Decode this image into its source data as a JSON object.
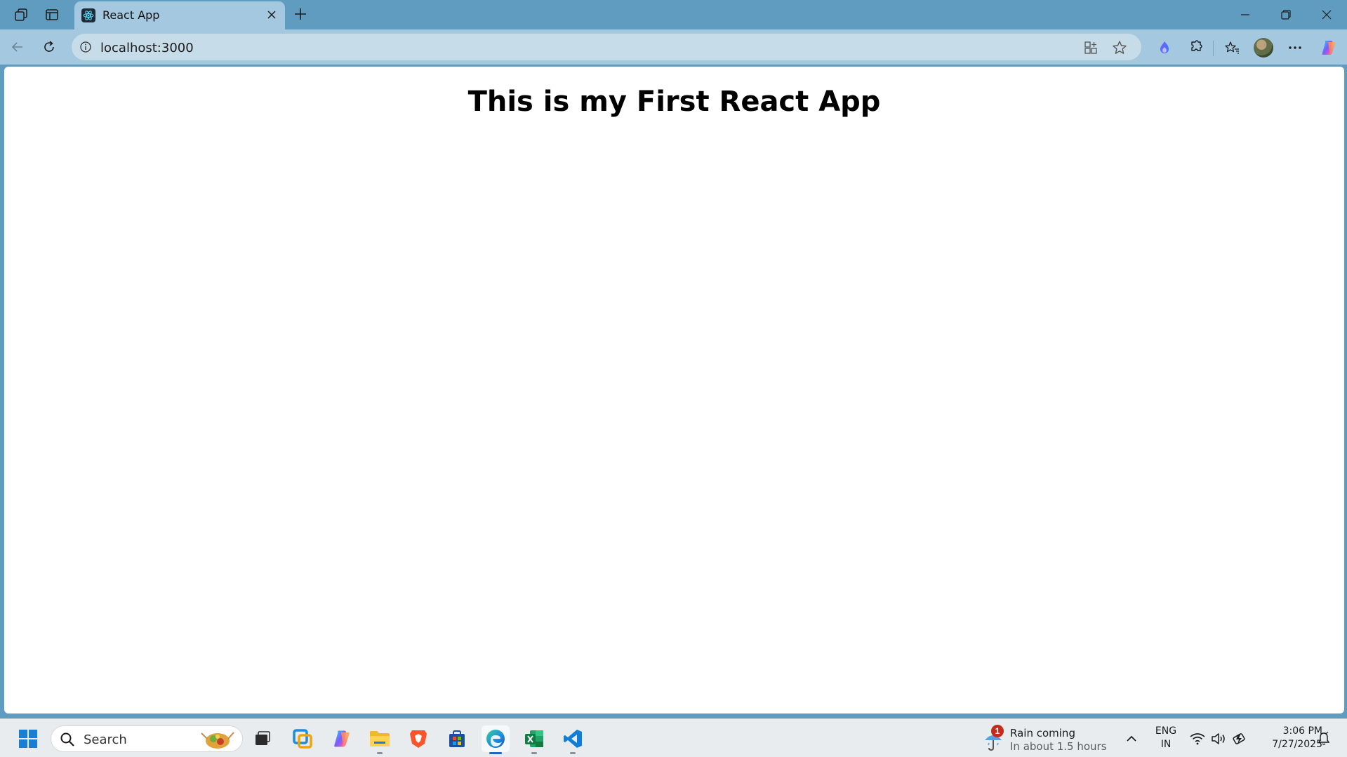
{
  "browser": {
    "tab": {
      "title": "React App"
    },
    "address_bar": {
      "url": "localhost:3000"
    }
  },
  "page": {
    "heading": "This is my First React App"
  },
  "taskbar": {
    "search": {
      "placeholder": "Search"
    },
    "apps": [
      "task-view",
      "microsoft-365",
      "copilot",
      "file-explorer",
      "brave",
      "microsoft-store",
      "edge",
      "excel",
      "vscode"
    ],
    "weather": {
      "badge": "1",
      "title": "Rain coming",
      "subtitle": "In about 1.5 hours"
    },
    "language": {
      "line1": "ENG",
      "line2": "IN"
    },
    "clock": {
      "time": "3:06 PM",
      "date": "7/27/2025"
    }
  },
  "colors": {
    "titlebar": "#5f9cc0",
    "toolbar": "#a3c8e0",
    "page_background": "#ffffff",
    "taskbar": "#e8ecef"
  }
}
